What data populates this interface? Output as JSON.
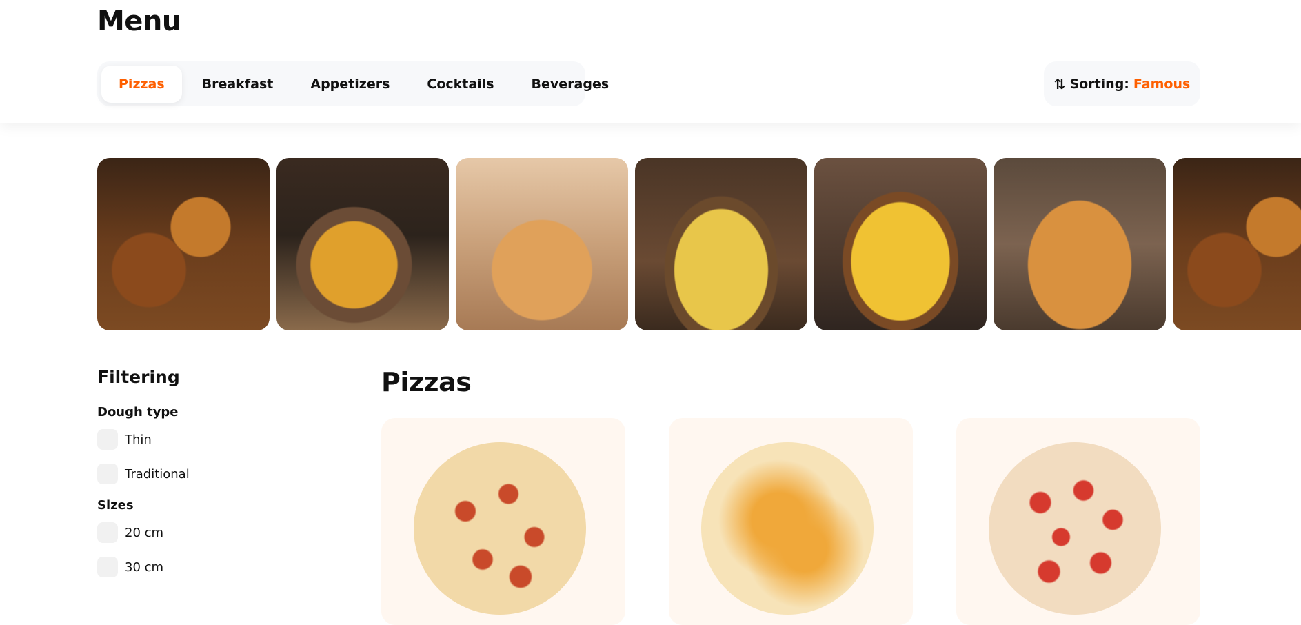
{
  "header": {
    "title": "Menu",
    "tabs": [
      {
        "label": "Pizzas",
        "active": true
      },
      {
        "label": "Breakfast",
        "active": false
      },
      {
        "label": "Appetizers",
        "active": false
      },
      {
        "label": "Cocktails",
        "active": false
      },
      {
        "label": "Beverages",
        "active": false
      }
    ],
    "sorting": {
      "label": "Sorting:",
      "value": "Famous",
      "icon": "sort-arrows-icon"
    }
  },
  "stories": [
    {
      "name": "story-burgers"
    },
    {
      "name": "story-nuggets"
    },
    {
      "name": "story-pastry-bites"
    },
    {
      "name": "story-mushroom-omelette"
    },
    {
      "name": "story-pepperoni-omelette"
    },
    {
      "name": "story-pizza-slice"
    },
    {
      "name": "story-burgers-2"
    }
  ],
  "sidebar": {
    "title": "Filtering",
    "groups": [
      {
        "title": "Dough type",
        "options": [
          "Thin",
          "Traditional"
        ]
      },
      {
        "title": "Sizes",
        "options": [
          "20 cm",
          "30 cm"
        ]
      }
    ]
  },
  "main": {
    "section_title": "Pizzas",
    "products": [
      {
        "name": "pizza-card-1"
      },
      {
        "name": "pizza-card-2"
      },
      {
        "name": "pizza-card-3"
      }
    ]
  },
  "colors": {
    "accent": "#fe5f00",
    "tab_bg": "#f7f8fa",
    "card_bg": "#fff7f0"
  }
}
